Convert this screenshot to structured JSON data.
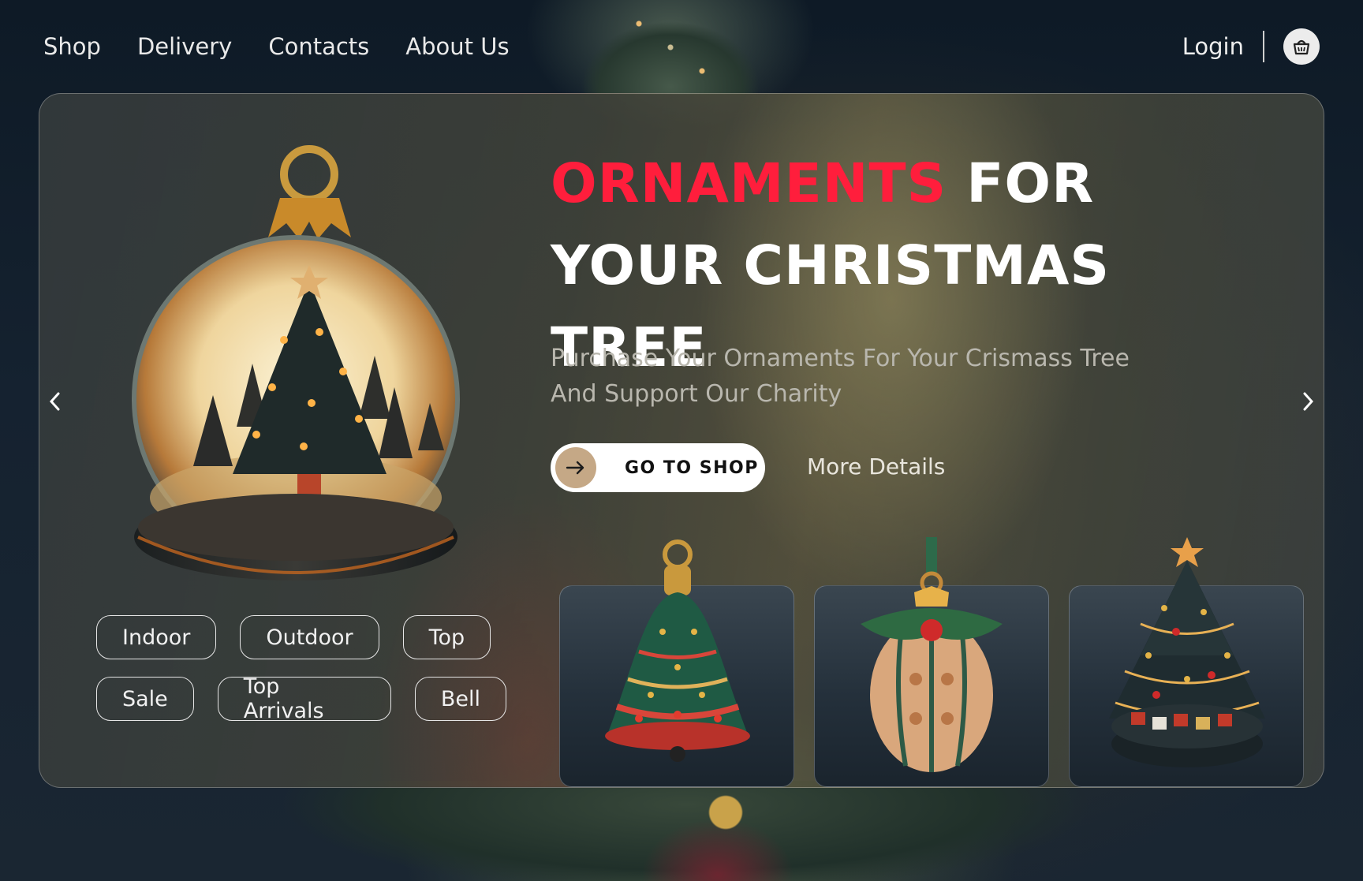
{
  "nav": {
    "links": [
      "Shop",
      "Delivery",
      "Contacts",
      "About Us"
    ],
    "login": "Login",
    "cart_icon": "basket-icon"
  },
  "hero": {
    "headline_highlight": "ORNAMENTS",
    "headline_rest_line1": " FOR",
    "headline_line2": "YOUR CHRISTMAS TREE",
    "subtitle_line1": "Purchase Your Ornaments For Your Crismass Tree",
    "subtitle_line2": "And Support Our Charity",
    "cta_label": "GO TO SHOP",
    "more_label": "More Details",
    "highlight_color": "#ff1e3c"
  },
  "tags": {
    "row1": [
      "Indoor",
      "Outdoor",
      "Top"
    ],
    "row2": [
      "Sale",
      "Top Arrivals",
      "Bell"
    ]
  },
  "products": [
    {
      "image": "bell-ornament"
    },
    {
      "image": "egg-ornament"
    },
    {
      "image": "christmas-tree"
    }
  ]
}
